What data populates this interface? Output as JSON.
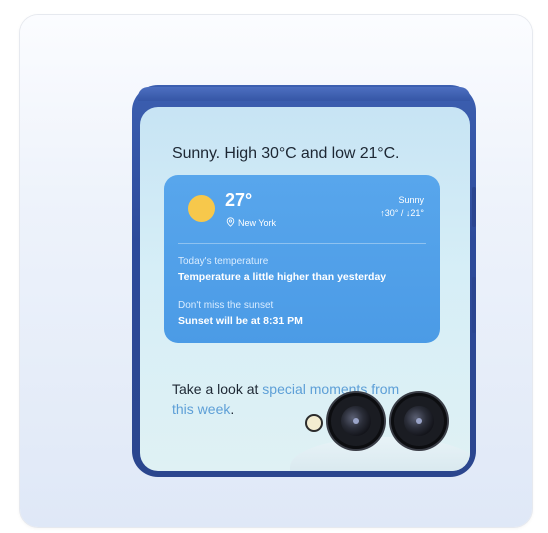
{
  "lockscreen": {
    "headline": "Sunny. High 30°C and low 21°C.",
    "weather": {
      "temperature": "27°",
      "location": "New York",
      "condition": "Sunny",
      "high_low": "↑30° / ↓21°",
      "items": [
        {
          "label": "Today's temperature",
          "value": "Temperature a little higher than yesterday"
        },
        {
          "label": "Don't miss the sunset",
          "value": "Sunset will be at 8:31 PM"
        }
      ],
      "colors": {
        "card": "#4b9be6",
        "sun": "#f7c84b"
      }
    },
    "moments": {
      "prefix": "Take a look at ",
      "highlight": "special moments from this week",
      "suffix": "."
    }
  },
  "icons": [
    "sun-icon",
    "location-pin-icon",
    "flash-icon",
    "camera-lens-icon"
  ]
}
